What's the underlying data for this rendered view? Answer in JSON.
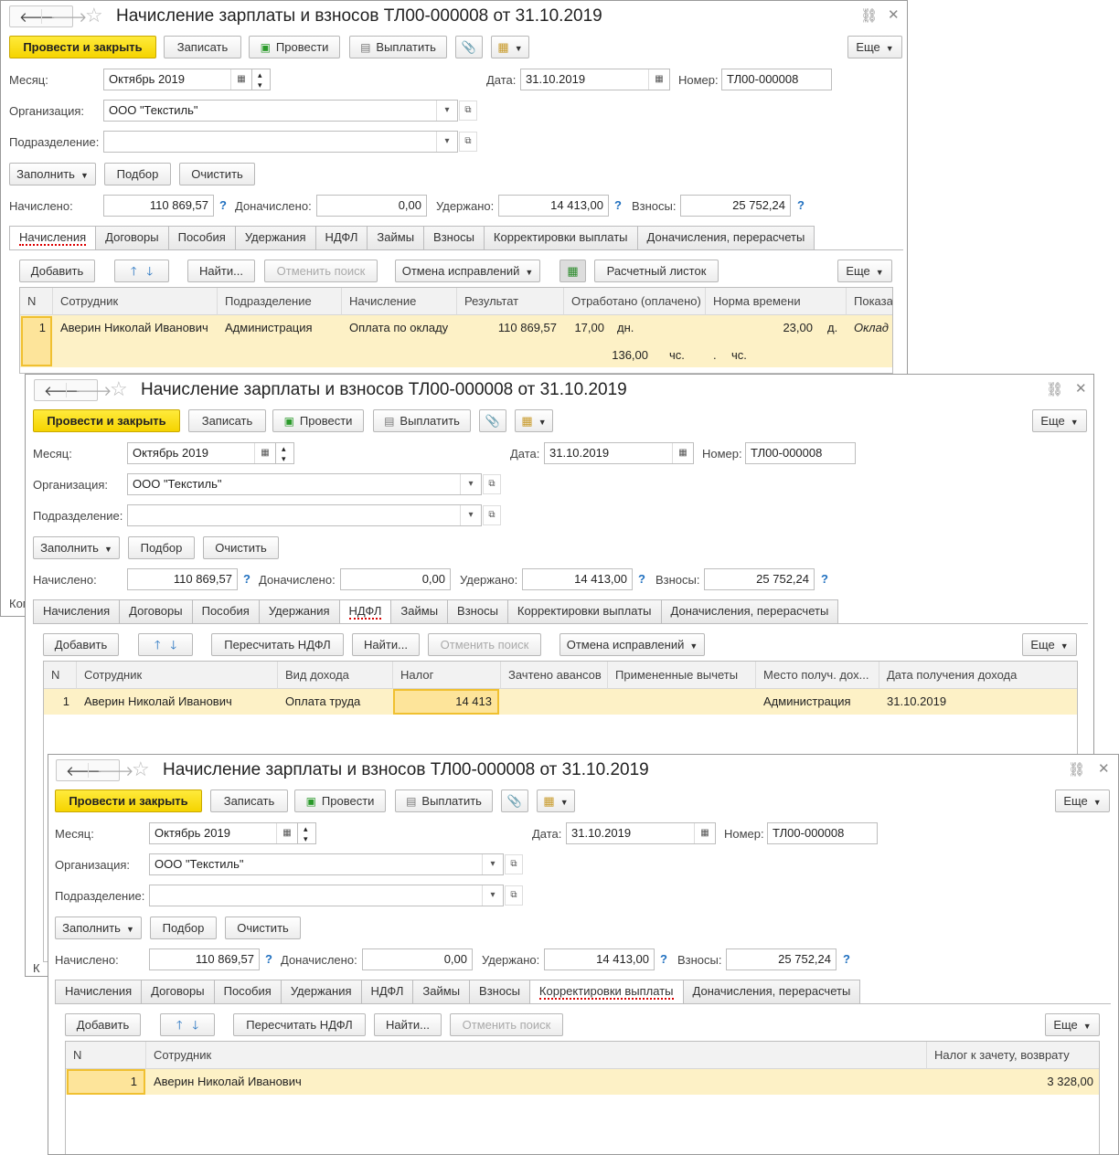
{
  "doc": {
    "title": "Начисление зарплаты и взносов ТЛ00-000008 от 31.10.2019",
    "nav": {
      "back_icon": "arrow-left-icon",
      "forward_icon": "arrow-right-icon",
      "star_icon": "star-icon"
    },
    "top_icons": {
      "link_icon": "link-icon",
      "close_icon": "close-icon"
    },
    "toolbar": {
      "post_close": "Провести и закрыть",
      "save": "Записать",
      "post": "Провести",
      "pay": "Выплатить",
      "more": "Еще"
    },
    "month_label": "Месяц:",
    "month_value": "Октябрь 2019",
    "date_label": "Дата:",
    "date_value": "31.10.2019",
    "number_label": "Номер:",
    "number_value": "ТЛ00-000008",
    "org_label": "Организация:",
    "org_value": "ООО \"Текстиль\"",
    "dept_label": "Подразделение:",
    "dept_value": "",
    "fill_btn": "Заполнить",
    "select_btn": "Подбор",
    "clear_btn": "Очистить",
    "accrued_label": "Начислено:",
    "accrued_value": "110 869,57",
    "extra_label": "Доначислено:",
    "extra_value": "0,00",
    "withheld_label": "Удержано:",
    "withheld_value": "14 413,00",
    "contrib_label": "Взносы:",
    "contrib_value": "25 752,24",
    "help": "?",
    "tabs": [
      "Начисления",
      "Договоры",
      "Пособия",
      "Удержания",
      "НДФЛ",
      "Займы",
      "Взносы",
      "Корректировки выплаты",
      "Доначисления, перерасчеты"
    ]
  },
  "w1": {
    "toolbar": {
      "add": "Добавить",
      "find": "Найти...",
      "cancel_search": "Отменить поиск",
      "undo_fix": "Отмена исправлений",
      "payslip": "Расчетный листок",
      "more": "Еще"
    },
    "headers": [
      "N",
      "Сотрудник",
      "Подразделение",
      "Начисление",
      "Результат",
      "Отработано (оплачено)",
      "Норма времени",
      "Показа"
    ],
    "row": {
      "n": "1",
      "employee": "Аверин Николай Иванович",
      "dept": "Администрация",
      "accrual": "Оплата по окладу",
      "result": "110 869,57",
      "worked_days": "17,00",
      "days_unit": "дн.",
      "norm_days": "23,00",
      "norm_unit": "д.",
      "indicator": "Оклад",
      "worked_hours": "136,00",
      "hours_unit": "чс.",
      "norm_hours": ".",
      "norm_hours_unit": "чс."
    },
    "behind_fragments": [
      "Ком",
      "К"
    ]
  },
  "w2": {
    "toolbar": {
      "add": "Добавить",
      "recalc": "Пересчитать НДФЛ",
      "find": "Найти...",
      "cancel_search": "Отменить поиск",
      "undo_fix": "Отмена исправлений",
      "more": "Еще"
    },
    "headers": [
      "N",
      "Сотрудник",
      "Вид дохода",
      "Налог",
      "Зачтено авансов",
      "Примененные вычеты",
      "Место получ. дох...",
      "Дата получения дохода"
    ],
    "row": {
      "n": "1",
      "employee": "Аверин Николай Иванович",
      "income": "Оплата труда",
      "tax": "14 413",
      "advances": "",
      "deductions": "",
      "place": "Администрация",
      "date": "31.10.2019"
    }
  },
  "w3": {
    "toolbar": {
      "add": "Добавить",
      "recalc": "Пересчитать НДФЛ",
      "find": "Найти...",
      "cancel_search": "Отменить поиск",
      "more": "Еще"
    },
    "headers": [
      "N",
      "Сотрудник",
      "Налог к зачету, возврату"
    ],
    "row": {
      "n": "1",
      "employee": "Аверин Николай Иванович",
      "tax_refund": "3 328,00"
    }
  }
}
